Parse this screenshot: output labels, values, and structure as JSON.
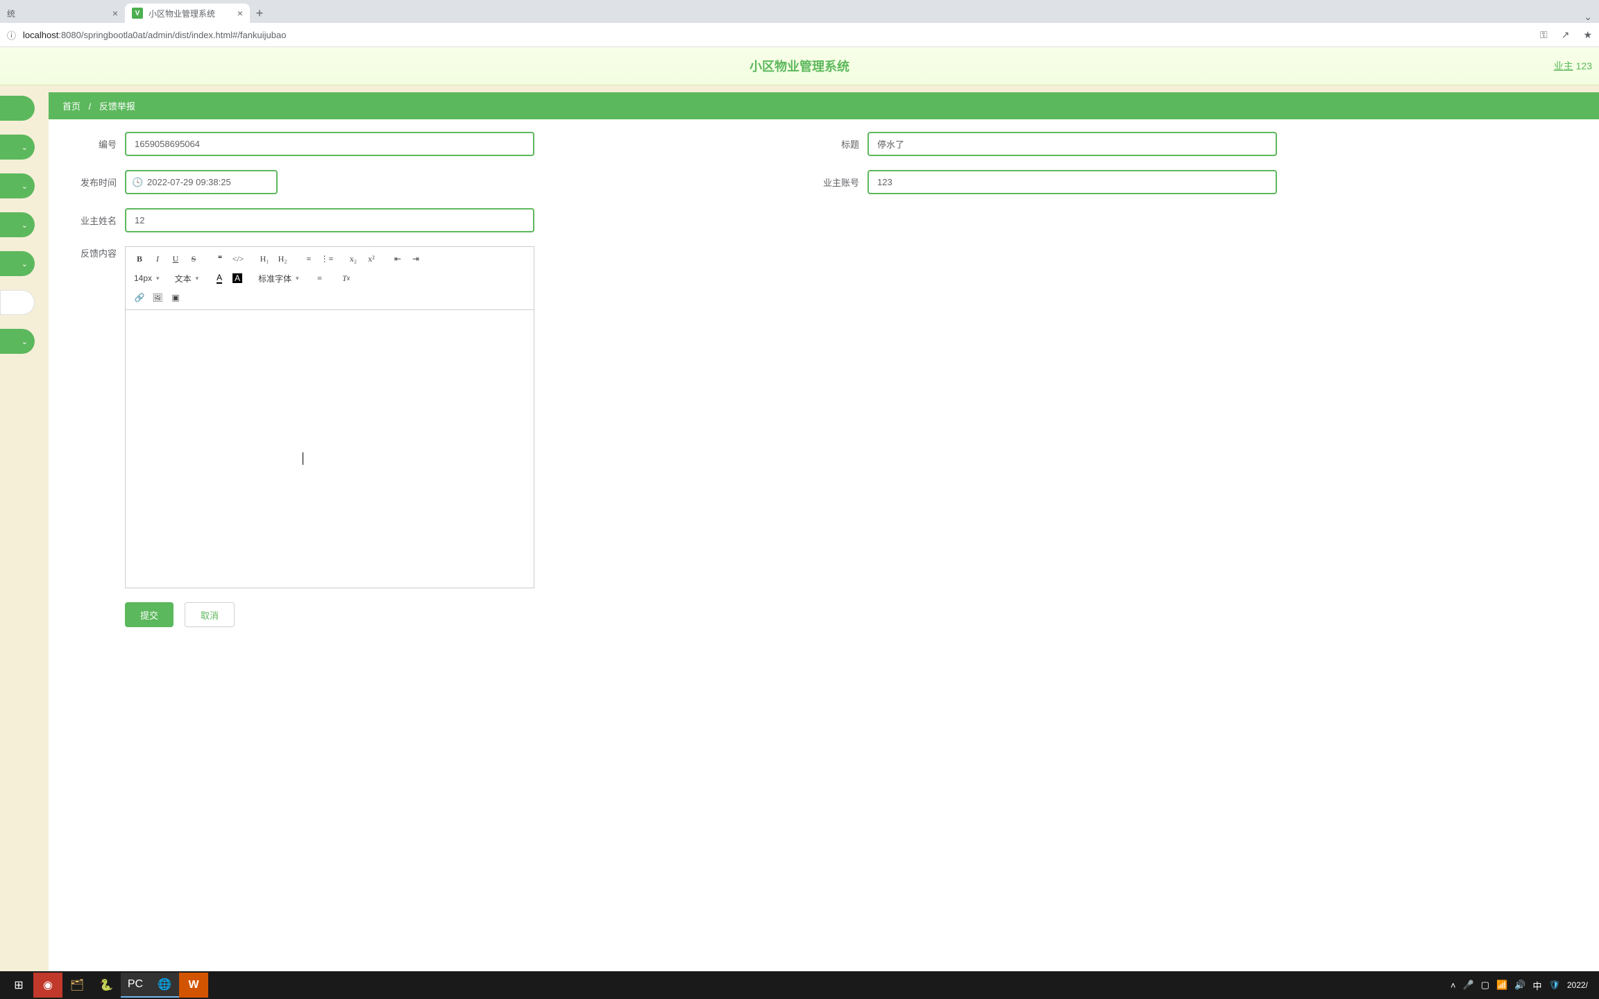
{
  "browser": {
    "tab1": {
      "title": "统"
    },
    "tab2": {
      "title": "小区物业管理系统"
    },
    "url_host": "localhost",
    "url_port_path": ":8080/springbootla0at/admin/dist/index.html#/fankuijubao"
  },
  "header": {
    "title": "小区物业管理系统",
    "user_role": "业主",
    "user_name": "123"
  },
  "breadcrumb": {
    "home": "首页",
    "sep": "/",
    "current": "反馈举报"
  },
  "form": {
    "labels": {
      "bianhao": "编号",
      "biaoti": "标题",
      "fabushijian": "发布时间",
      "yezhuzhanghao": "业主账号",
      "yezhuxingming": "业主姓名",
      "fankuineirong": "反馈内容"
    },
    "values": {
      "bianhao": "1659058695064",
      "biaoti": "停水了",
      "fabushijian": "2022-07-29 09:38:25",
      "yezhuzhanghao": "123",
      "yezhuxingming": "12"
    }
  },
  "toolbar": {
    "fontsize": "14px",
    "style_label": "文本",
    "font_label": "标准字体",
    "h1": "H₁",
    "h2": "H₂",
    "sub": "x₂",
    "sup": "x²"
  },
  "buttons": {
    "submit": "提交",
    "cancel": "取消"
  },
  "taskbar": {
    "ime": "中",
    "date": "2022/"
  }
}
